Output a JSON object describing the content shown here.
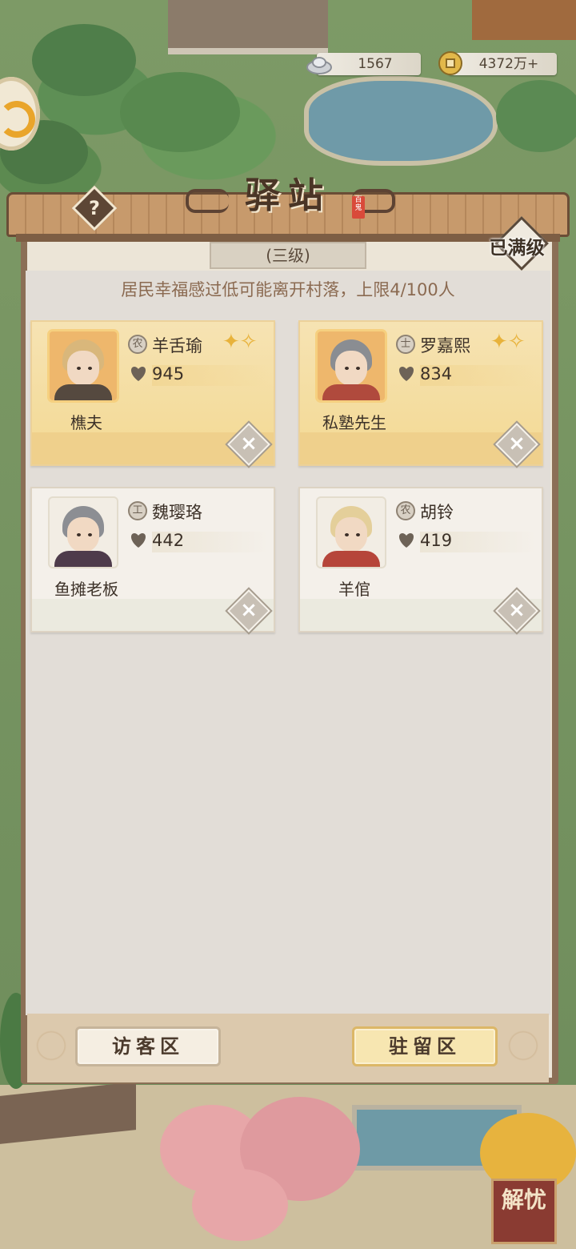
{
  "currency": {
    "silver": "1567",
    "coins": "4372万+"
  },
  "header": {
    "title": "驿站",
    "seal": "百鬼",
    "level": "(三级)",
    "maxed": "已满级",
    "help": "?"
  },
  "notice": "居民幸福感过低可能离开村落，上限4/100人",
  "residents": [
    {
      "class_icon": "农",
      "name": "羊舌瑜",
      "happiness": "945",
      "job": "樵夫",
      "style": "gold"
    },
    {
      "class_icon": "士",
      "name": "罗嘉熙",
      "happiness": "834",
      "job": "私塾先生",
      "style": "gold"
    },
    {
      "class_icon": "工",
      "name": "魏璎珞",
      "happiness": "442",
      "job": "鱼摊老板",
      "style": "plain"
    },
    {
      "class_icon": "农",
      "name": "胡铃",
      "happiness": "419",
      "job": "羊倌",
      "style": "plain"
    }
  ],
  "tabs": {
    "visitor": "访客区",
    "resident": "驻留区"
  },
  "worry_button": "解忧",
  "colors": {
    "panel_frame": "#8b6f56",
    "gold_card": "#f3d993",
    "plain_card": "#f4f0ea",
    "text_brown": "#8b6a51"
  }
}
